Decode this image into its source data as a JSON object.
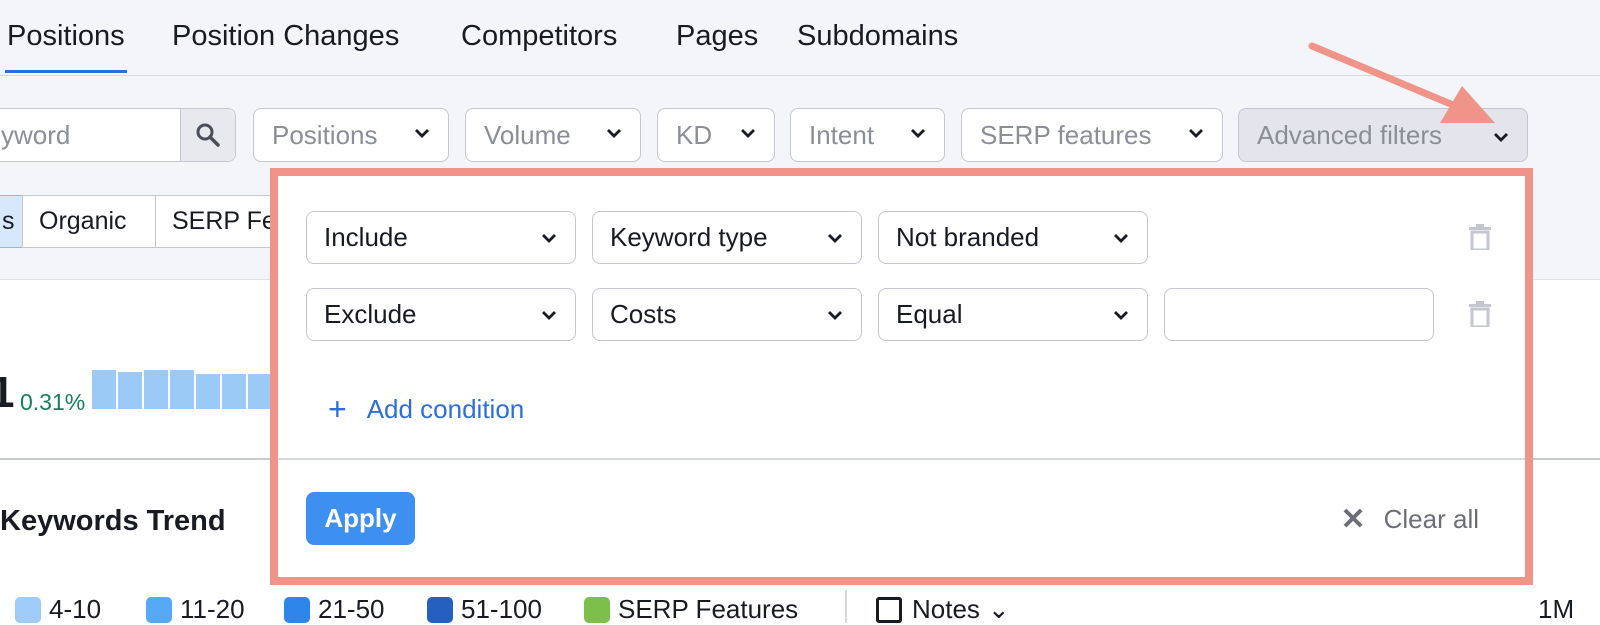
{
  "tabs": [
    {
      "label": "Positions",
      "active": true
    },
    {
      "label": "Position Changes"
    },
    {
      "label": "Competitors"
    },
    {
      "label": "Pages"
    },
    {
      "label": "Subdomains"
    }
  ],
  "search": {
    "value": "yword"
  },
  "filters": [
    "Positions",
    "Volume",
    "KD",
    "Intent",
    "SERP features",
    "Advanced filters"
  ],
  "segments": [
    "s",
    "Organic",
    "SERP Fe"
  ],
  "metric": {
    "value": "1",
    "change": "0.31%",
    "bars": [
      1,
      0.95,
      1,
      1,
      0.9,
      0.9,
      0.9
    ]
  },
  "trend_title": "Keywords Trend",
  "legend": [
    {
      "label": "4-10",
      "color": "#9ecbf7"
    },
    {
      "label": "11-20",
      "color": "#56aaf5"
    },
    {
      "label": "21-50",
      "color": "#2f86ea"
    },
    {
      "label": "51-100",
      "color": "#2460bf"
    },
    {
      "label": "SERP Features",
      "color": "#7cc04b"
    }
  ],
  "notes_label": "Notes",
  "period_label": "1M",
  "advanced": {
    "rows": [
      {
        "mode": "Include",
        "field": "Keyword type",
        "operator": "Not branded"
      },
      {
        "mode": "Exclude",
        "field": "Costs",
        "operator": "Equal",
        "value": ""
      }
    ],
    "add_condition": "Add condition",
    "apply": "Apply",
    "clear_all": "Clear all"
  },
  "colors": {
    "accent": "#2d6fd6",
    "highlight": "#f0948a",
    "apply": "#3d8ff0"
  }
}
